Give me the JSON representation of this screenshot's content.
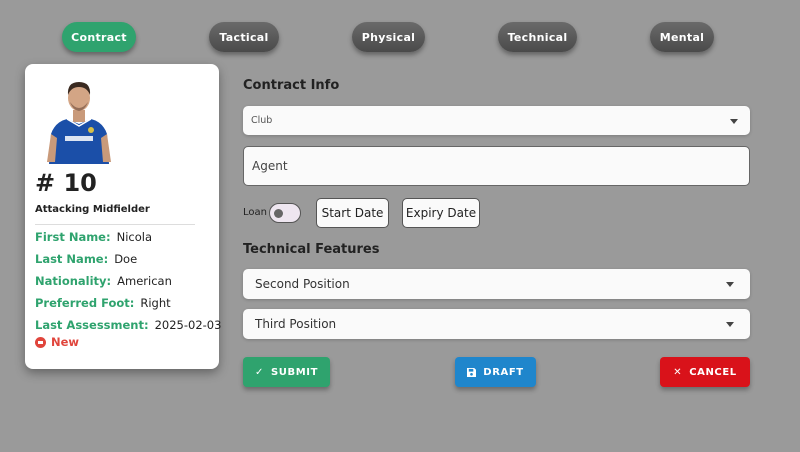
{
  "tabs": [
    {
      "label": "Contract",
      "active": true
    },
    {
      "label": "Tactical",
      "active": false
    },
    {
      "label": "Physical",
      "active": false
    },
    {
      "label": "Technical",
      "active": false
    },
    {
      "label": "Mental",
      "active": false
    }
  ],
  "player": {
    "number": "# 10",
    "role": "Attacking Midfielder",
    "info": [
      {
        "label": "First Name:",
        "value": "Nicola"
      },
      {
        "label": "Last Name:",
        "value": "Doe"
      },
      {
        "label": "Nationality:",
        "value": "American"
      },
      {
        "label": "Preferred Foot:",
        "value": "Right"
      },
      {
        "label": "Last Assessment:",
        "value": "2025-02-03"
      }
    ],
    "badge": "New",
    "photo_icon": "player-photo"
  },
  "form": {
    "contract_title": "Contract Info",
    "club_label": "Club",
    "agent_label": "Agent",
    "loan_label": "Loan",
    "start_date": "Start Date",
    "expiry_date": "Expiry Date",
    "technical_title": "Technical Features",
    "second_position": "Second Position",
    "third_position": "Third Position"
  },
  "actions": {
    "submit": "SUBMIT",
    "draft": "DRAFT",
    "cancel": "CANCEL"
  },
  "colors": {
    "accent_green": "#2fa36e",
    "draft_blue": "#1f86cc",
    "cancel_red": "#d9121a",
    "background": "#9a9a9a"
  }
}
